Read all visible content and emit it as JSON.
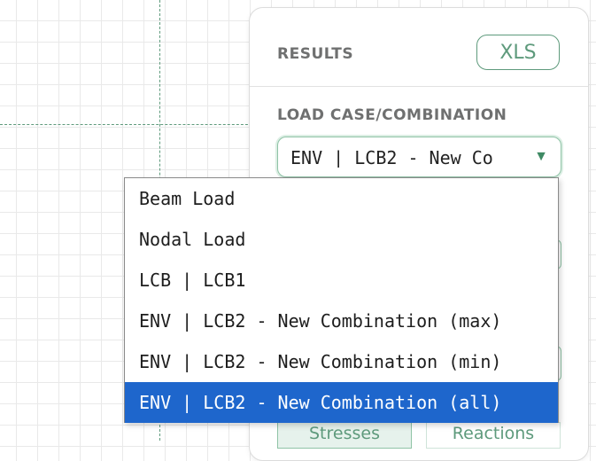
{
  "results_panel": {
    "title": "RESULTS",
    "export_label": "XLS",
    "load_case_label": "LOAD CASE/COMBINATION",
    "selected_value": "ENV | LCB2 - New Co",
    "tabs": [
      "Stresses",
      "Reactions"
    ]
  },
  "dropdown": {
    "options": [
      "Beam Load",
      "Nodal Load",
      "LCB | LCB1",
      "ENV | LCB2 - New Combination (max)",
      "ENV | LCB2 - New Combination (min)",
      "ENV | LCB2 - New Combination (all)"
    ],
    "selected_index": 5
  },
  "colors": {
    "accent": "#5e9a7c",
    "selection": "#1e66cc"
  },
  "icons": {
    "select_arrow": "▼"
  }
}
